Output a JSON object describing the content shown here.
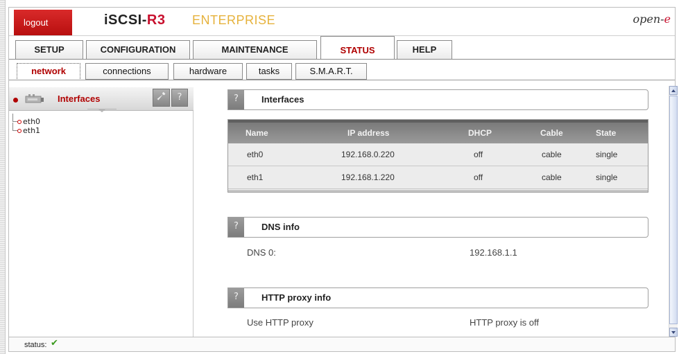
{
  "header": {
    "logout_label": "logout",
    "brand_main": "iSCSI-",
    "brand_suffix": "R3",
    "edition": "ENTERPRISE",
    "vendor_main": "open-",
    "vendor_suffix": "e"
  },
  "main_tabs": [
    {
      "label": "SETUP"
    },
    {
      "label": "CONFIGURATION"
    },
    {
      "label": "MAINTENANCE"
    },
    {
      "label": "STATUS",
      "active": true
    },
    {
      "label": "HELP"
    }
  ],
  "sub_tabs": [
    {
      "label": "network",
      "active": true
    },
    {
      "label": "connections"
    },
    {
      "label": "hardware"
    },
    {
      "label": "tasks"
    },
    {
      "label": "S.M.A.R.T."
    }
  ],
  "left_panel": {
    "title": "Interfaces",
    "help_label": "?",
    "tree": [
      "eth0",
      "eth1"
    ]
  },
  "sections": {
    "interfaces": {
      "help_label": "?",
      "title": "Interfaces",
      "columns": [
        "Name",
        "IP address",
        "DHCP",
        "Cable",
        "State"
      ],
      "rows": [
        [
          "eth0",
          "192.168.0.220",
          "off",
          "cable",
          "single"
        ],
        [
          "eth1",
          "192.168.1.220",
          "off",
          "cable",
          "single"
        ]
      ]
    },
    "dns": {
      "help_label": "?",
      "title": "DNS info",
      "label": "DNS 0:",
      "value": "192.168.1.1"
    },
    "proxy": {
      "help_label": "?",
      "title": "HTTP proxy info",
      "label": "Use HTTP proxy",
      "value": "HTTP proxy is off"
    }
  },
  "status_bar": {
    "label": "status:",
    "icon": "check-icon"
  },
  "colors": {
    "brand_red": "#c8102e",
    "edition_gold": "#e6b23c",
    "active_tab": "#b00000",
    "status_ok": "#3a9a1d"
  }
}
